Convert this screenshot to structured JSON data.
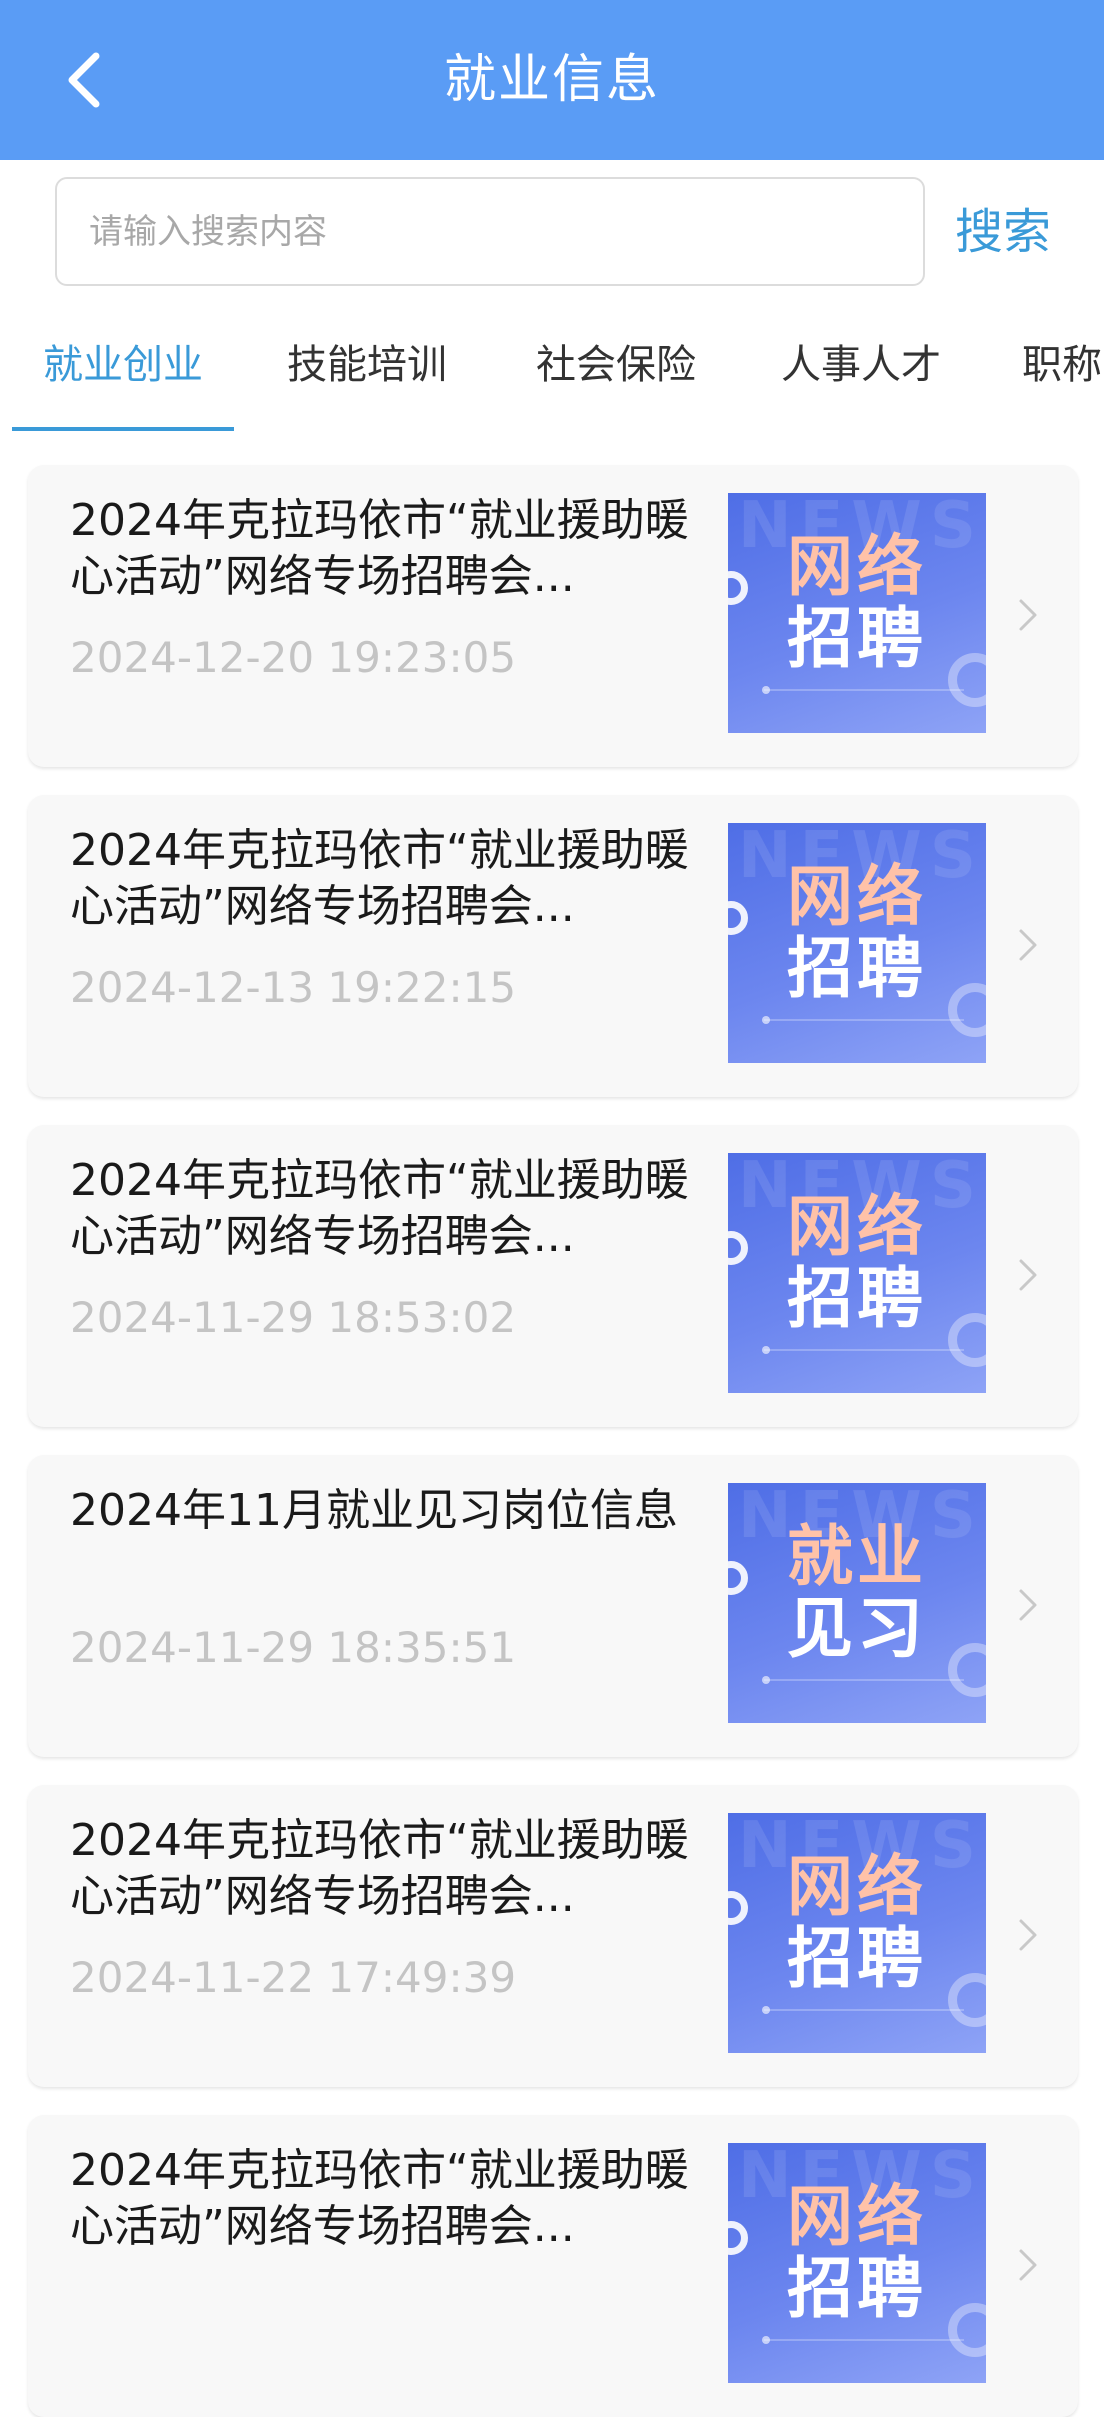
{
  "header": {
    "title": "就业信息",
    "background": "#5a9cf5"
  },
  "search": {
    "placeholder": "请输入搜索内容",
    "button_label": "搜索"
  },
  "tabs": [
    {
      "label": "就业创业",
      "active": true
    },
    {
      "label": "技能培训",
      "active": false
    },
    {
      "label": "社会保险",
      "active": false
    },
    {
      "label": "人事人才",
      "active": false
    },
    {
      "label": "职称",
      "active": false
    }
  ],
  "accent_color": "#3a9ad8",
  "articles": [
    {
      "title": "2024年克拉玛依市“就业援助暖心活动”网络专场招聘会...",
      "time": "2024-12-20 19:23:05",
      "thumb": [
        "网络",
        "招聘"
      ]
    },
    {
      "title": "2024年克拉玛依市“就业援助暖心活动”网络专场招聘会...",
      "time": "2024-12-13 19:22:15",
      "thumb": [
        "网络",
        "招聘"
      ]
    },
    {
      "title": "2024年克拉玛依市“就业援助暖心活动”网络专场招聘会...",
      "time": "2024-11-29 18:53:02",
      "thumb": [
        "网络",
        "招聘"
      ]
    },
    {
      "title": "2024年11月就业见习岗位信息",
      "time": "2024-11-29 18:35:51",
      "thumb": [
        "就业",
        "见习"
      ]
    },
    {
      "title": "2024年克拉玛依市“就业援助暖心活动”网络专场招聘会...",
      "time": "2024-11-22 17:49:39",
      "thumb": [
        "网络",
        "招聘"
      ]
    },
    {
      "title": "2024年克拉玛依市“就业援助暖心活动”网络专场招聘会...",
      "time": "",
      "thumb": [
        "网络",
        "招聘"
      ]
    }
  ],
  "thumb_watermark": "NEWS",
  "icons": {
    "back": "chevron-left-icon",
    "arrow": "chevron-right-icon"
  }
}
